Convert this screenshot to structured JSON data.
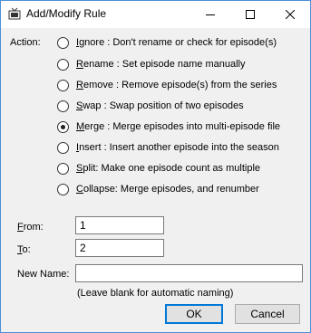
{
  "window": {
    "title": "Add/Modify Rule",
    "icon": "tv-icon",
    "controls": {
      "minimize": "minimize-icon",
      "maximize": "maximize-icon",
      "close": "close-icon"
    }
  },
  "action": {
    "label": "Action:",
    "selected": "merge",
    "options": [
      {
        "key": "ignore",
        "mnemonic": "I",
        "rest": "gnore : Don't rename or check for episode(s)"
      },
      {
        "key": "rename",
        "mnemonic": "R",
        "rest": "ename : Set episode name manually"
      },
      {
        "key": "remove",
        "mnemonic": "R",
        "rest": "emove : Remove episode(s) from the series"
      },
      {
        "key": "swap",
        "mnemonic": "S",
        "rest": "wap : Swap position of two episodes"
      },
      {
        "key": "merge",
        "mnemonic": "M",
        "rest": "erge : Merge episodes into multi-episode file"
      },
      {
        "key": "insert",
        "mnemonic": "I",
        "rest": "nsert : Insert another episode into the season"
      },
      {
        "key": "split",
        "mnemonic": "S",
        "rest": "plit: Make one episode count as multiple"
      },
      {
        "key": "collapse",
        "mnemonic": "C",
        "rest": "ollapse: Merge episodes, and renumber"
      }
    ]
  },
  "fields": {
    "from": {
      "mnemonic": "F",
      "rest": "rom:",
      "value": "1"
    },
    "to": {
      "mnemonic": "T",
      "rest": "o:",
      "value": "2"
    },
    "new_name": {
      "label": "New Name:",
      "value": ""
    },
    "hint": "(Leave blank for automatic naming)"
  },
  "buttons": {
    "ok": "OK",
    "cancel": "Cancel"
  }
}
